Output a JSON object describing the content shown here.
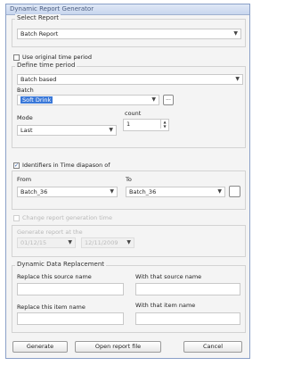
{
  "window": {
    "title": "Dynamic Report Generator"
  },
  "select_report": {
    "legend": "Select Report",
    "value": "Batch Report"
  },
  "use_original": {
    "label": "Use original time period",
    "checked": false
  },
  "define_time": {
    "legend": "Define time period",
    "period_value": "Batch based",
    "batch_label": "Batch",
    "batch_value": "Soft Drink",
    "browse_label": "...",
    "mode_label": "Mode",
    "mode_value": "Last",
    "count_label": "count",
    "count_value": "1"
  },
  "identifiers": {
    "label": "Identifiers in Time diapason of",
    "checked": true,
    "from_label": "From",
    "from_value": "Batch_36",
    "to_label": "To",
    "to_value": "Batch_36"
  },
  "change_time": {
    "label": "Change report generation time",
    "checked": false,
    "generate_label": "Generate report at the",
    "date_value": "01/12/15",
    "time_value": "12/11/2009"
  },
  "replacement": {
    "legend": "Dynamic Data Replacement",
    "replace_source_label": "Replace this source name",
    "with_source_label": "With that source name",
    "replace_item_label": "Replace this item name",
    "with_item_label": "With that item name"
  },
  "buttons": {
    "generate": "Generate",
    "open_file": "Open report file",
    "cancel": "Cancel"
  },
  "colors": {
    "selection": "#3a78d8",
    "border_blue": "#8aa0c8"
  }
}
